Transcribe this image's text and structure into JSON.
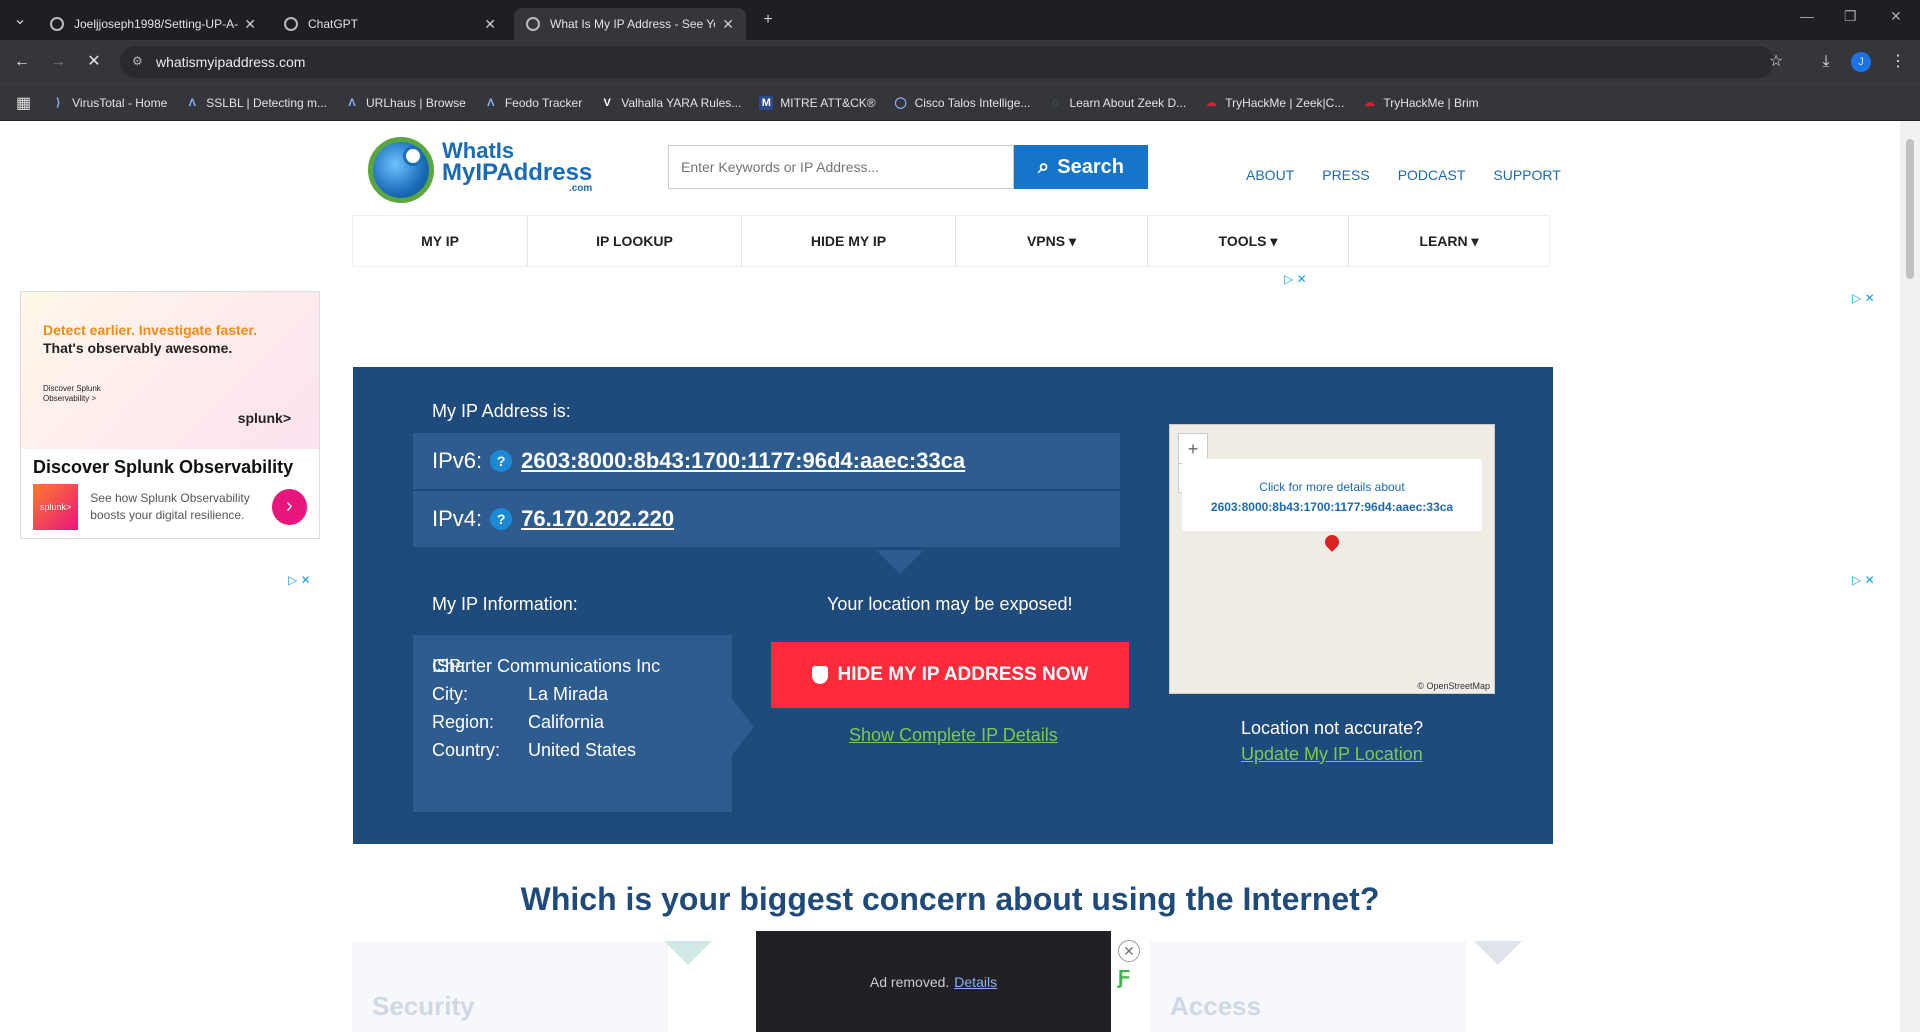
{
  "browser": {
    "tabs": [
      {
        "title": "Joeljjoseph1998/Setting-UP-A-",
        "active": false
      },
      {
        "title": "ChatGPT",
        "active": false
      },
      {
        "title": "What Is My IP Address - See Yo",
        "active": true
      }
    ],
    "url": "whatismyipaddress.com",
    "profile_initial": "J",
    "bookmarks": [
      "VirusTotal - Home",
      "SSLBL | Detecting m...",
      "URLhaus | Browse",
      "Feodo Tracker",
      "Valhalla YARA Rules...",
      "MITRE ATT&CK®",
      "Cisco Talos Intellige...",
      "Learn About Zeek D...",
      "TryHackMe | Zeek|C...",
      "TryHackMe | Brim"
    ]
  },
  "site": {
    "logo": {
      "line1": "WhatIs",
      "line2": "MyIPAddress",
      "line3": ".com"
    },
    "search": {
      "placeholder": "Enter Keywords or IP Address...",
      "button": "Search"
    },
    "top_links": [
      "ABOUT",
      "PRESS",
      "PODCAST",
      "SUPPORT"
    ],
    "nav": [
      "MY IP",
      "IP LOOKUP",
      "HIDE MY IP",
      "VPNS ▾",
      "TOOLS ▾",
      "LEARN ▾"
    ]
  },
  "ad_left": {
    "headline_orange": "Detect earlier. Investigate faster.",
    "headline_dark": "That's observably awesome.",
    "small": "Discover Splunk Observability >",
    "brand": "splunk>",
    "title": "Discover Splunk Observability",
    "icon_text": "splunk>",
    "desc": "See how Splunk Observability boosts your digital resilience.",
    "go": "›"
  },
  "ip": {
    "heading": "My IP Address is:",
    "ipv6_label": "IPv6:",
    "ipv6": "2603:8000:8b43:1700:1177:96d4:aaec:33ca",
    "ipv4_label": "IPv4:",
    "ipv4": "76.170.202.220",
    "help": "?",
    "info_heading": "My IP Information:",
    "info": [
      {
        "k": "ISP:",
        "v": "Charter Communications Inc"
      },
      {
        "k": "City:",
        "v": "La Mirada"
      },
      {
        "k": "Region:",
        "v": "California"
      },
      {
        "k": "Country:",
        "v": "United States"
      }
    ],
    "exposed": "Your location may be exposed!",
    "hide_button": "HIDE MY IP ADDRESS NOW",
    "show_details": "Show Complete IP Details",
    "map": {
      "zoom_in": "+",
      "zoom_out": "−",
      "popup_line1": "Click for more details about",
      "popup_line2": "2603:8000:8b43:1700:1177:96d4:aaec:33ca",
      "attribution": "© OpenStreetMap"
    },
    "location_q": "Location not accurate?",
    "update_link": "Update My IP Location"
  },
  "concern": {
    "heading": "Which is your biggest concern about using the Internet?",
    "card_left": "Security",
    "card_right": "Access"
  },
  "ad_removed": {
    "text": "Ad removed.",
    "link": "Details"
  }
}
